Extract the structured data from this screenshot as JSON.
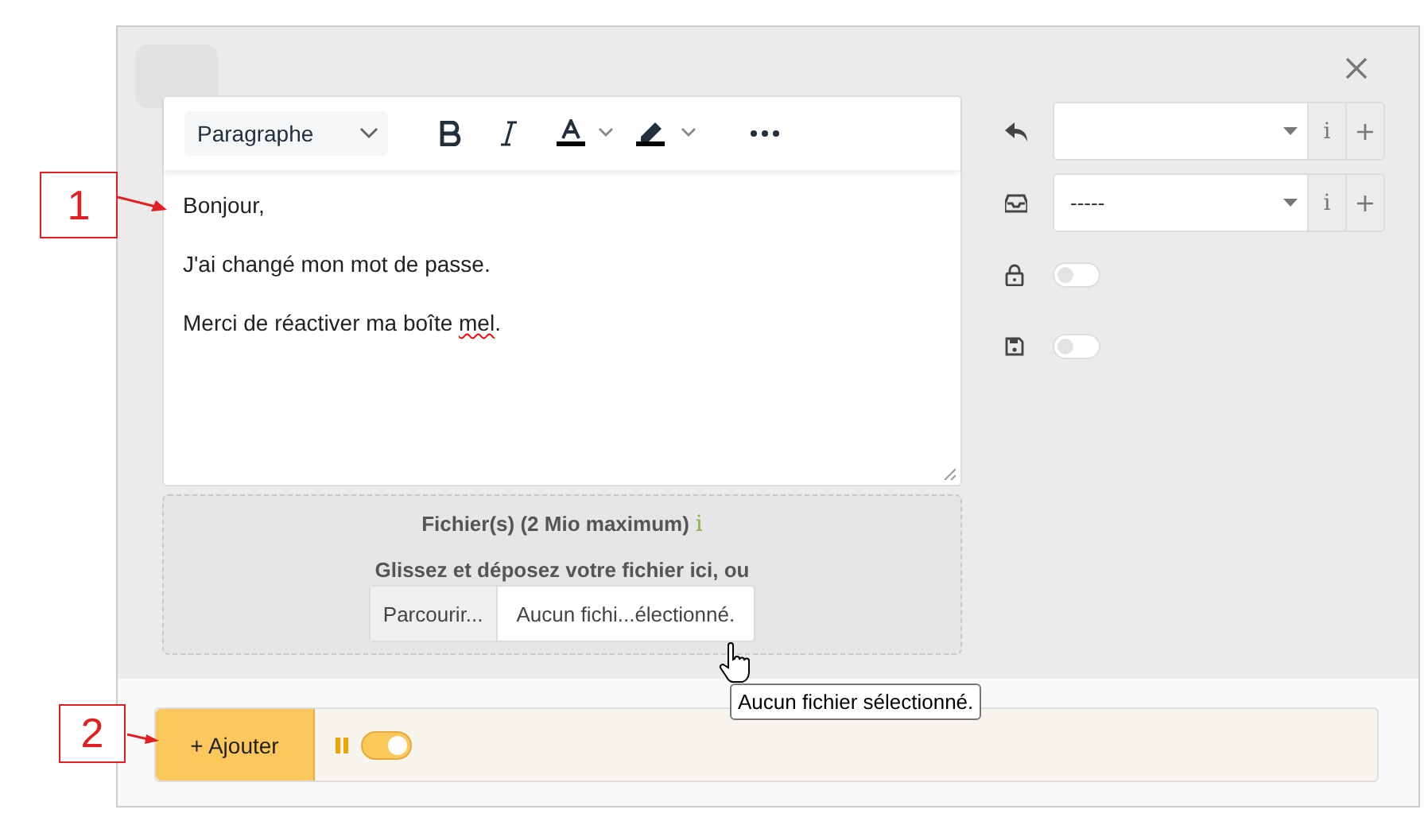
{
  "callouts": [
    {
      "label": "1"
    },
    {
      "label": "2"
    }
  ],
  "editor": {
    "format": "Paragraphe",
    "paragraphs": [
      {
        "parts": [
          {
            "text": "Bonjour,",
            "misspelled": false
          }
        ]
      },
      {
        "parts": [
          {
            "text": "J'ai changé mon mot de passe.",
            "misspelled": false
          }
        ]
      },
      {
        "parts": [
          {
            "text": "Merci de réactiver ma boîte ",
            "misspelled": false
          },
          {
            "text": "mel",
            "misspelled": true
          },
          {
            "text": ".",
            "misspelled": false
          }
        ]
      }
    ]
  },
  "attachments": {
    "title": "Fichier(s) (2 Mio maximum)",
    "info": "i",
    "prompt": "Glissez et déposez votre fichier ici, ou",
    "browse": "Parcourir...",
    "filename": "Aucun fichi...électionné.",
    "tooltip": "Aucun fichier sélectionné."
  },
  "settings": [
    {
      "kind": "select",
      "info": "i",
      "add": "+"
    },
    {
      "kind": "select",
      "value": "-----",
      "info": "i",
      "add": "+"
    },
    {
      "kind": "toggle",
      "on": false
    },
    {
      "kind": "toggle",
      "on": false
    }
  ],
  "footer": {
    "add_button": "+ Ajouter",
    "toggle_on": true
  }
}
